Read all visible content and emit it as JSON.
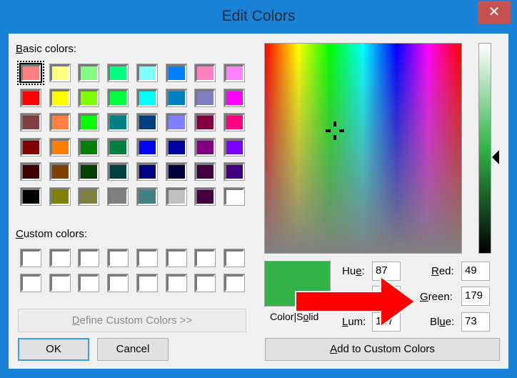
{
  "window": {
    "title": "Edit Colors",
    "close_glyph": "✕"
  },
  "basic_colors": {
    "label_accel": "B",
    "label_rest": "asic colors:",
    "selected_index": 0,
    "swatches": [
      "#ff8080",
      "#ffff80",
      "#80ff80",
      "#00ff80",
      "#80ffff",
      "#0080ff",
      "#ff80c0",
      "#ff80ff",
      "#ff0000",
      "#ffff00",
      "#80ff00",
      "#00ff40",
      "#00ffff",
      "#0080c0",
      "#8080c0",
      "#ff00ff",
      "#804040",
      "#ff8040",
      "#00ff00",
      "#008080",
      "#004080",
      "#8080ff",
      "#800040",
      "#ff0080",
      "#800000",
      "#ff8000",
      "#008000",
      "#008040",
      "#0000ff",
      "#0000a0",
      "#800080",
      "#8000ff",
      "#400000",
      "#804000",
      "#004000",
      "#004040",
      "#000080",
      "#000040",
      "#400040",
      "#400080",
      "#000000",
      "#808000",
      "#808040",
      "#808080",
      "#408080",
      "#c0c0c0",
      "#400040",
      "#ffffff"
    ]
  },
  "custom_colors": {
    "label_accel": "C",
    "label_rest": "ustom colors:",
    "swatches": [
      "#ffffff",
      "#ffffff",
      "#ffffff",
      "#ffffff",
      "#ffffff",
      "#ffffff",
      "#ffffff",
      "#ffffff",
      "#ffffff",
      "#ffffff",
      "#ffffff",
      "#ffffff",
      "#ffffff",
      "#ffffff",
      "#ffffff",
      "#ffffff"
    ]
  },
  "buttons": {
    "define_accel": "D",
    "define_rest": "efine Custom Colors >>",
    "ok": "OK",
    "cancel": "Cancel",
    "add_accel": "A",
    "add_rest": "dd to Custom Colors"
  },
  "preview": {
    "color": "#31b349",
    "label_pre": "Color|S",
    "label_accel": "o",
    "label_post": "lid"
  },
  "values": {
    "hue_pre": "Hu",
    "hue_accel": "e",
    "hue_post": ":",
    "hue": "87",
    "sat": "",
    "lum_accel": "L",
    "lum_post": "um:",
    "lum": "107",
    "red_accel": "R",
    "red_post": "ed:",
    "red": "49",
    "green_accel": "G",
    "green_post": "reen:",
    "green": "179",
    "blue_pre": "Bl",
    "blue_accel": "u",
    "blue_post": "e:",
    "blue": "73"
  },
  "annotation": {
    "arrow_color": "#ff0000",
    "points_to": "Green"
  }
}
